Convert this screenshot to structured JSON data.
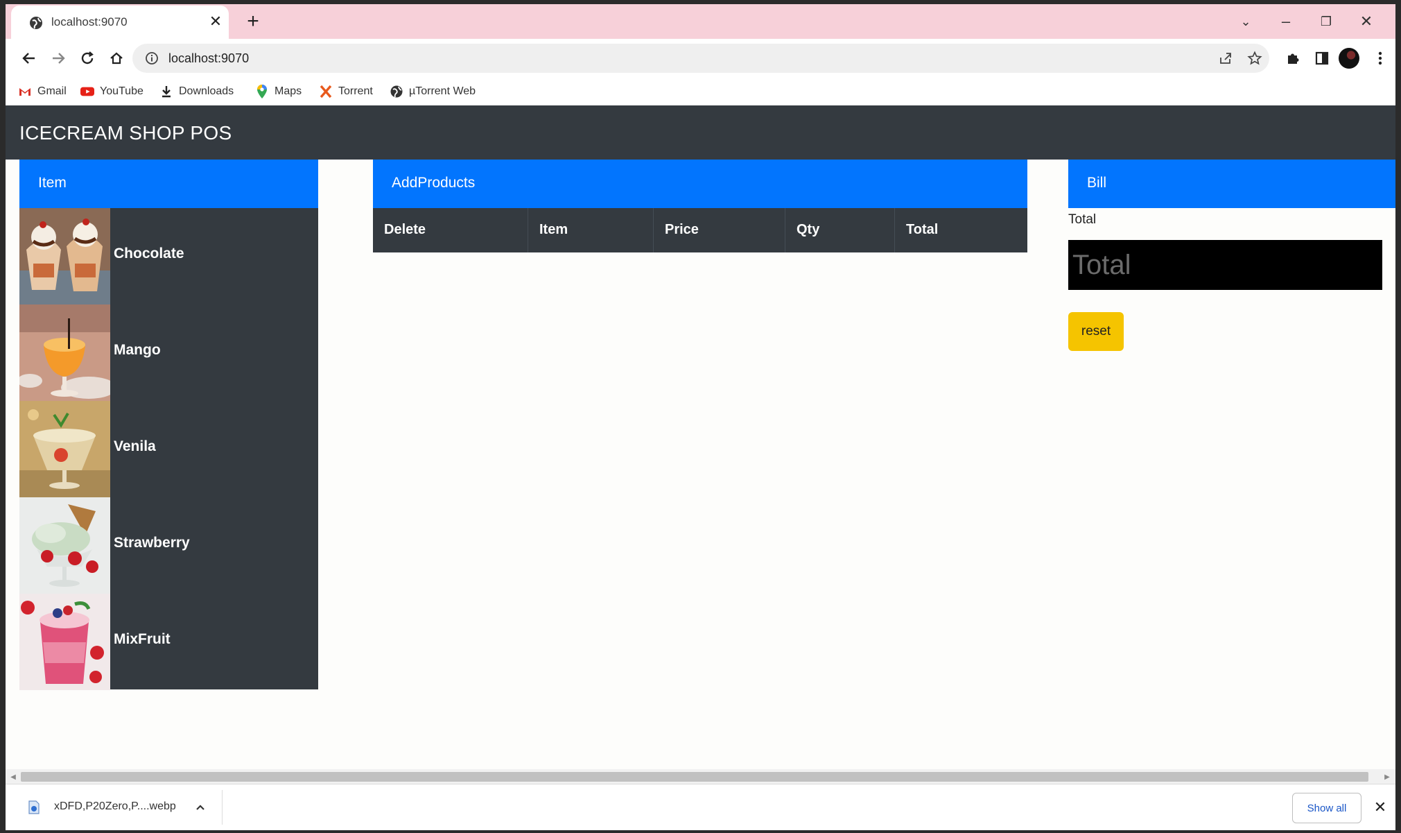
{
  "browser": {
    "tab_title": "localhost:9070",
    "url": "localhost:9070",
    "bookmarks": [
      {
        "label": "Gmail",
        "icon": "gmail-icon"
      },
      {
        "label": "YouTube",
        "icon": "youtube-icon"
      },
      {
        "label": "Downloads",
        "icon": "download-icon"
      },
      {
        "label": "Maps",
        "icon": "maps-icon"
      },
      {
        "label": "Torrent",
        "icon": "torrent-icon"
      },
      {
        "label": "µTorrent Web",
        "icon": "globe-icon"
      }
    ]
  },
  "app": {
    "brand": "ICECREAM SHOP POS",
    "item_panel": {
      "header": "Item",
      "items": [
        {
          "name": "Chocolate"
        },
        {
          "name": "Mango"
        },
        {
          "name": "Venila"
        },
        {
          "name": "Strawberry"
        },
        {
          "name": "MixFruit"
        }
      ]
    },
    "products_panel": {
      "header": "AddProducts",
      "columns": [
        "Delete",
        "Item",
        "Price",
        "Qty",
        "Total"
      ]
    },
    "bill_panel": {
      "header": "Bill",
      "total_label": "Total",
      "total_placeholder": "Total",
      "reset_label": "reset"
    }
  },
  "download_bar": {
    "file_name": "xDFD,P20Zero,P....webp",
    "show_all_label": "Show all"
  },
  "colors": {
    "primary": "#0275fe",
    "dark": "#343a40",
    "warning": "#f5c400",
    "tab_strip": "#f7d0d9"
  }
}
